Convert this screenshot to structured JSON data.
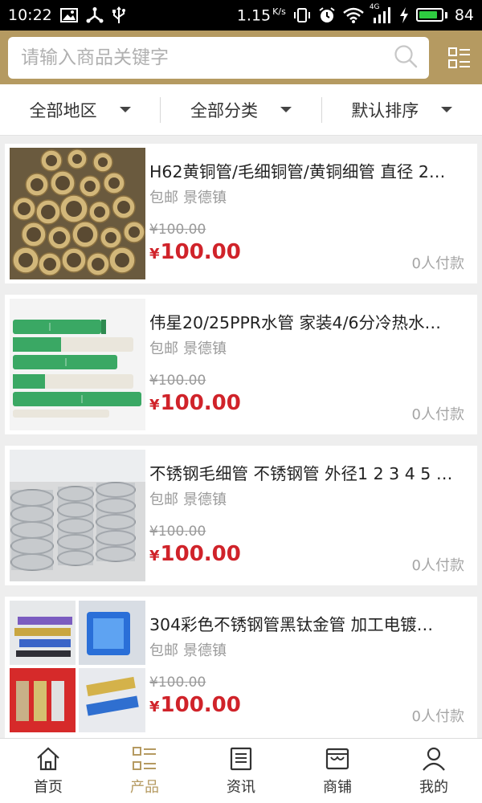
{
  "status_bar": {
    "time": "10:22",
    "speed": "1.15",
    "speed_unit": "K/s",
    "network": "4G",
    "battery": "84",
    "battery_level": 0.84
  },
  "search": {
    "placeholder": "请输入商品关键字"
  },
  "filters": [
    {
      "label": "全部地区"
    },
    {
      "label": "全部分类"
    },
    {
      "label": "默认排序"
    }
  ],
  "currency_symbol": "¥",
  "products": [
    {
      "title": "H62黄铜管/毛细铜管/黄铜细管 直径 2…",
      "shipping": "包邮",
      "location": "景德镇",
      "old_price": "¥100.00",
      "price": "100.00",
      "buyers": "0人付款",
      "image": "brass-pipes-image"
    },
    {
      "title": "伟星20/25PPR水管 家装4/6分冷热水…",
      "shipping": "包邮",
      "location": "景德镇",
      "old_price": "¥100.00",
      "price": "100.00",
      "buyers": "0人付款",
      "image": "ppr-pipes-image"
    },
    {
      "title": "不锈钢毛细管 不锈钢管 外径1 2 3 4 5 …",
      "shipping": "包邮",
      "location": "景德镇",
      "old_price": "¥100.00",
      "price": "100.00",
      "buyers": "0人付款",
      "image": "steel-coils-image"
    },
    {
      "title": "304彩色不锈钢管黑钛金管 加工电镀…",
      "shipping": "包邮",
      "location": "景德镇",
      "old_price": "¥100.00",
      "price": "100.00",
      "buyers": "0人付款",
      "image": "colored-steel-tubes-image"
    }
  ],
  "nav": [
    {
      "label": "首页",
      "icon": "home-icon"
    },
    {
      "label": "产品",
      "icon": "product-grid-icon",
      "active": true
    },
    {
      "label": "资讯",
      "icon": "news-icon"
    },
    {
      "label": "商铺",
      "icon": "shop-icon"
    },
    {
      "label": "我的",
      "icon": "user-icon"
    }
  ],
  "colors": {
    "brand": "#b59a61",
    "price": "#d0232a",
    "status_bar": "#000000"
  }
}
